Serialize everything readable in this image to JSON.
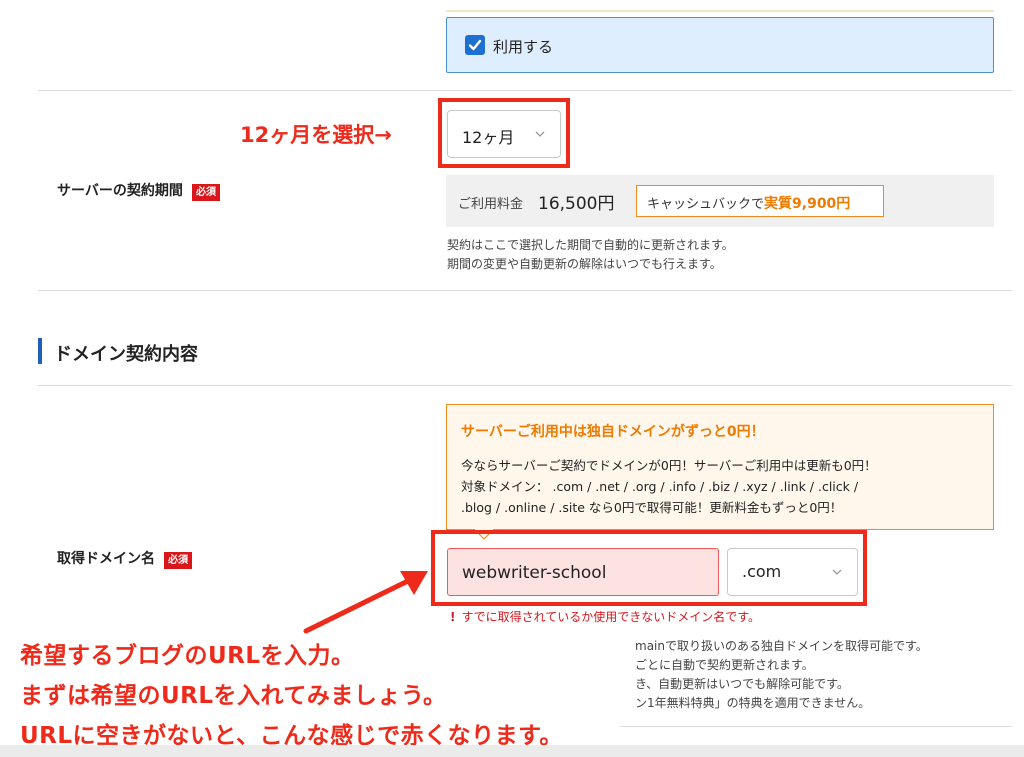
{
  "plan_option": {
    "use_label": "利用する"
  },
  "contract_period": {
    "label": "サーバーの契約期間",
    "required_badge": "必須",
    "annotation": "12ヶ月を選択→",
    "selected": "12ヶ月",
    "price_label": "ご利用料金",
    "price_value": "16,500円",
    "cashback_prefix": "キャッシュバックで",
    "cashback_value": "実質9,900円",
    "note_line1": "契約はここで選択した期間で自動的に更新されます。",
    "note_line2": "期間の変更や自動更新の解除はいつでも行えます。"
  },
  "domain_section": {
    "heading": "ドメイン契約内容",
    "promo_title": "サーバーご利用中は独自ドメインがずっと0円！",
    "promo_line1": "今ならサーバーご契約でドメインが0円！サーバーご利用中は更新も0円！",
    "promo_line2": "対象ドメイン： .com / .net / .org / .info / .biz / .xyz / .link / .click /",
    "promo_line3": ".blog / .online / .site なら0円で取得可能！更新料金もずっと0円！",
    "field_label": "取得ドメイン名",
    "required_badge": "必須",
    "input_value": "webwriter-school",
    "tld_selected": ".com",
    "error_icon": "!",
    "error_text": "すでに取得されているか使用できないドメイン名です。",
    "info_line1": "mainで取り扱いのある独自ドメインを取得可能です。",
    "info_line2": "ごとに自動で契約更新されます。",
    "info_line3": "き、自動更新はいつでも解除可能です。",
    "info_line4": "ン1年無料特典」の特典を適用できません。"
  },
  "annotations": {
    "line1": "希望するブログのURLを入力。",
    "line2": "まずは希望のURLを入れてみましょう。",
    "line3": "URLに空きがないと、こんな感じで赤くなります。"
  },
  "colors": {
    "annotation_red": "#ee2a1b",
    "accent_orange": "#ef7a00",
    "required_red": "#d9171b",
    "checkbox_blue": "#1f6fd1",
    "section_bar_blue": "#1f5fb8"
  }
}
